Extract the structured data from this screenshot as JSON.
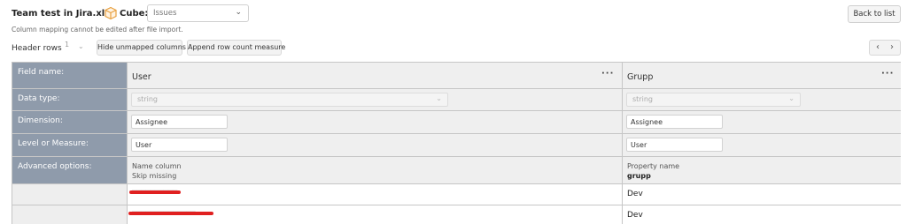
{
  "header": {
    "file_title": "Team test in Jira.xlsx",
    "cube_label": "Cube:",
    "cube_value": "Issues",
    "mapping_note": "Column mapping cannot be edited after file import.",
    "back_label": "Back to list"
  },
  "toolbar": {
    "header_rows_label": "Header rows",
    "header_rows_value": "1",
    "hide_unmapped_label": "Hide unmapped columns",
    "append_count_label": "Append row count measure"
  },
  "grid": {
    "row_labels": {
      "field_name": "Field name:",
      "data_type": "Data type:",
      "dimension": "Dimension:",
      "level_measure": "Level or Measure:",
      "advanced": "Advanced options:"
    },
    "columns": [
      {
        "name": "User",
        "data_type": "string",
        "dimension": "Assignee",
        "level": "User",
        "adv_line1": "Name column",
        "adv_line2": "Skip missing"
      },
      {
        "name": "Grupp",
        "data_type": "string",
        "dimension": "Assignee",
        "level": "User",
        "adv_line1": "Property name",
        "adv_line2": "grupp"
      }
    ],
    "rows": [
      {
        "col2": "Dev"
      },
      {
        "col2": "Dev"
      }
    ]
  },
  "icons": {
    "cube": "cube-icon",
    "more": "more-dots-icon",
    "chevron": "chevron-down-icon"
  },
  "colors": {
    "label_column": "#8f9bab",
    "header_bg": "#efefef",
    "redaction": "#e02020",
    "cube_icon": "#e8a040"
  }
}
